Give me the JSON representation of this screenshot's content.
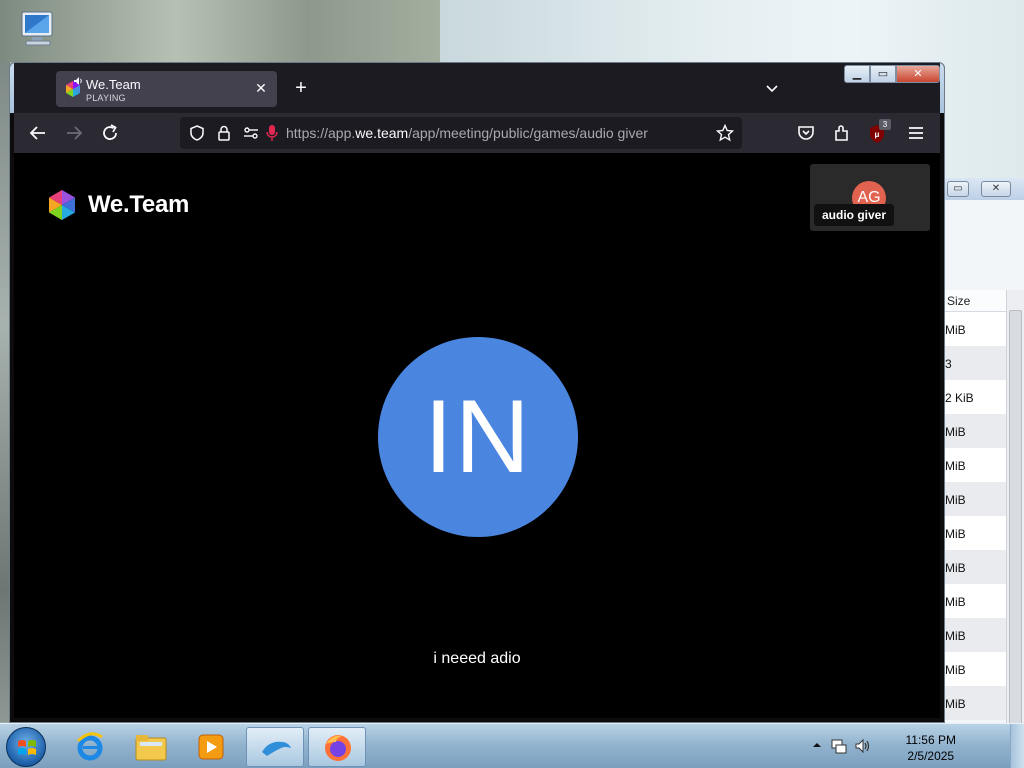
{
  "browser": {
    "tab": {
      "title": "We.Team",
      "status": "PLAYING"
    },
    "url": {
      "prefix": "https://app.",
      "domain": "we.team",
      "path": "/app/meeting/public/games/audio giver"
    },
    "extension_badge": "3"
  },
  "page": {
    "brand": "We.Team",
    "participant_tile": {
      "initials": "AG",
      "name": "audio giver"
    },
    "main_avatar": {
      "initials": "IN",
      "color": "#4a86e0"
    },
    "caption": "i neeed adio"
  },
  "background_window": {
    "column_header": "Size",
    "rows": [
      "MiB",
      "3",
      "2 KiB",
      "MiB",
      "MiB",
      "MiB",
      "MiB",
      "MiB",
      "MiB",
      "MiB",
      "MiB",
      "MiB"
    ]
  },
  "taskbar": {
    "time": "11:56 PM",
    "date": "2/5/2025"
  },
  "colors": {
    "tile_avatar": "#e1634f",
    "mic_active": "#e22850"
  }
}
